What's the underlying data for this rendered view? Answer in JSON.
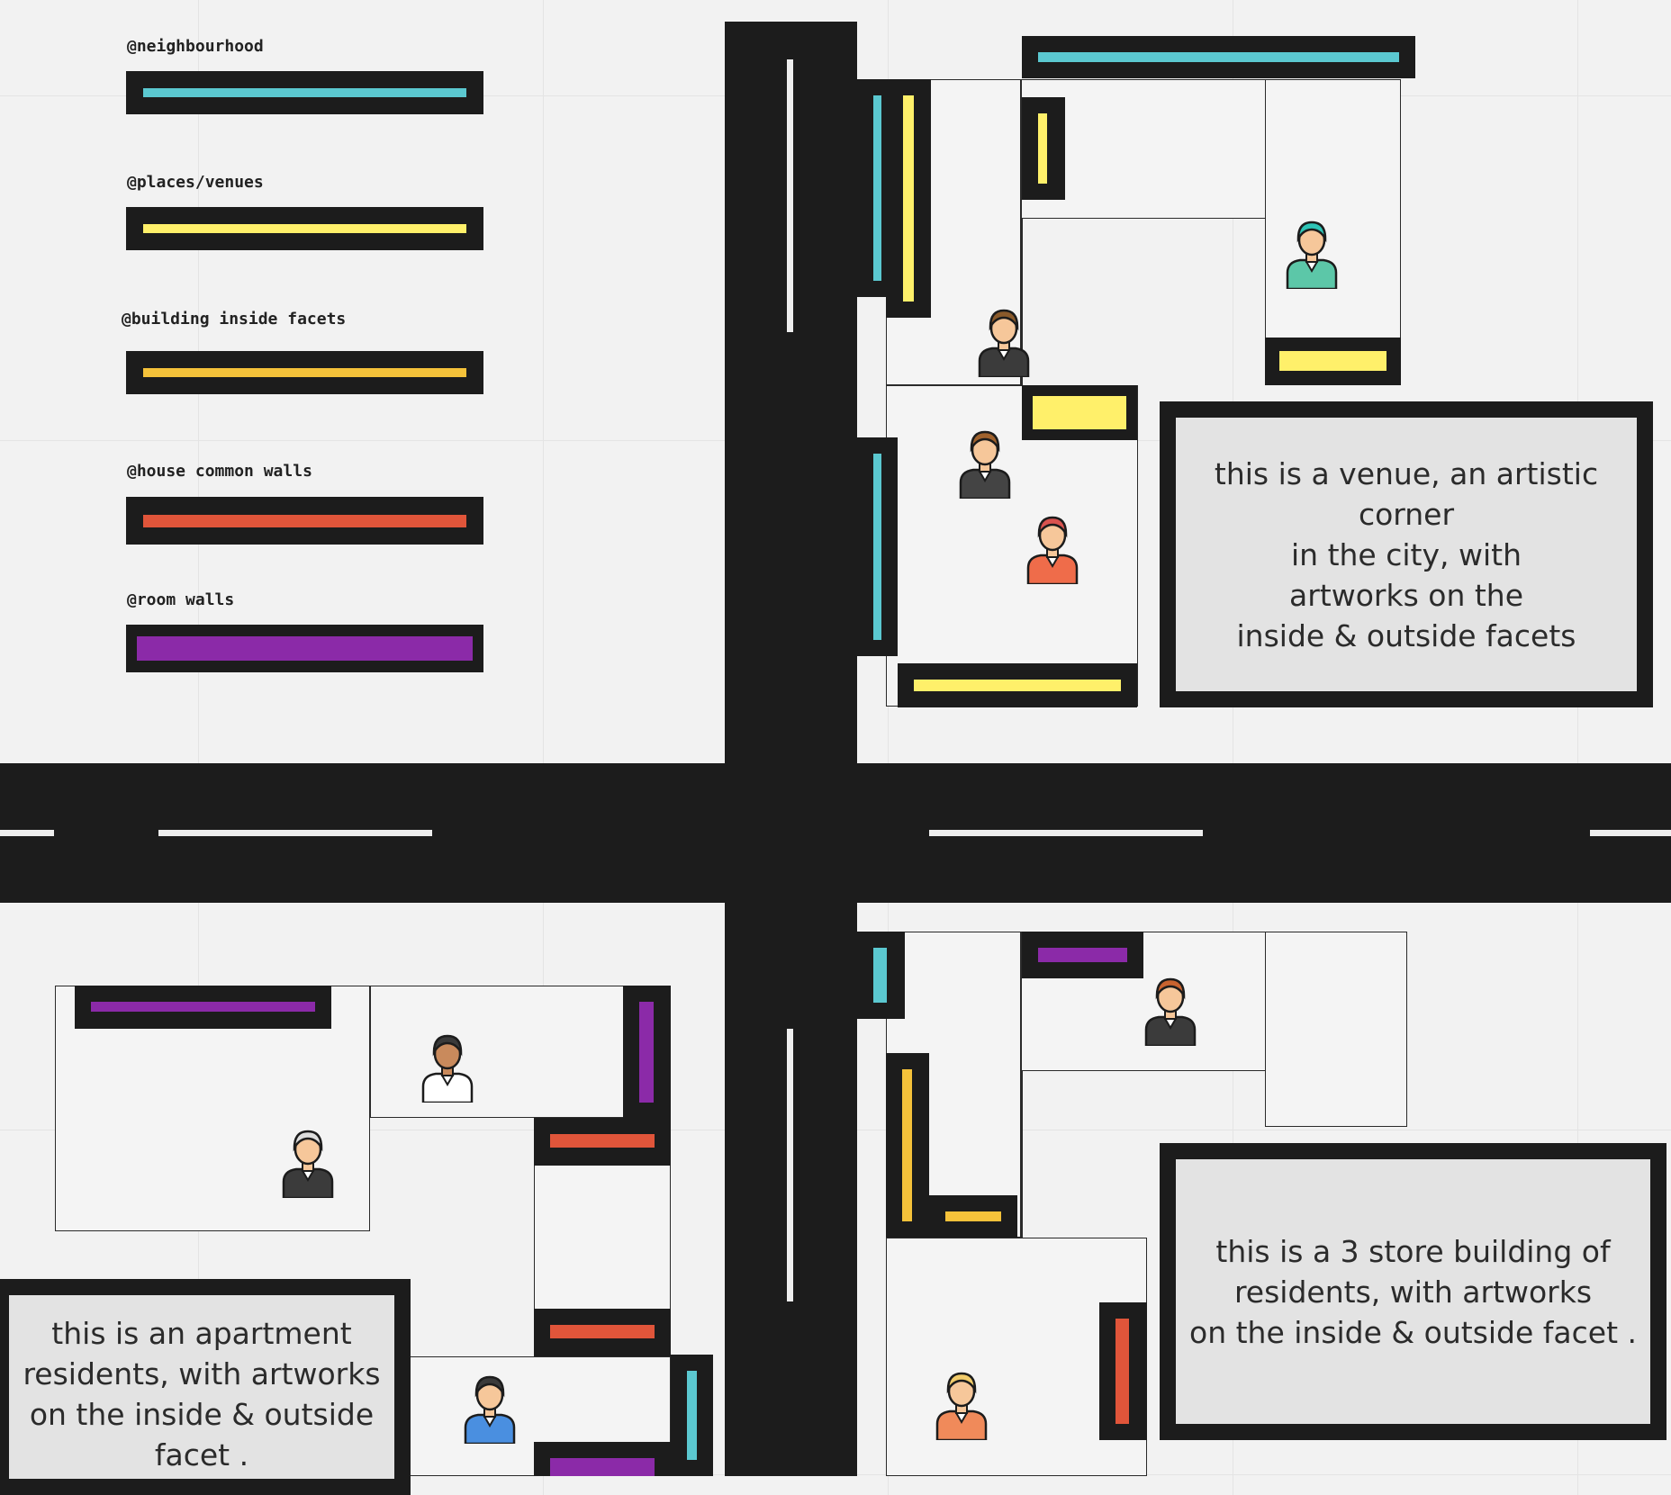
{
  "legend": [
    {
      "label": "@neighbourhood",
      "color": "#5bc8d0"
    },
    {
      "label": "@places/venues",
      "color": "#fff06a"
    },
    {
      "label": "@building inside facets",
      "color": "#f5c23a"
    },
    {
      "label": "@house common walls",
      "color": "#e0553a"
    },
    {
      "label": "@room walls",
      "color": "#8b2aa8"
    }
  ],
  "notes": {
    "venue": "this is a venue, an artistic corner\nin the city, with\nartworks on the\ninside &  outside facets",
    "building": "this is a 3 store building of\nresidents, with artworks\non the inside & outside facet .",
    "apartment": "this is an apartment\nresidents, with artworks\non the inside & outside\nfacet ."
  },
  "people": [
    {
      "name": "man-glasses-woman-icon",
      "hair": "#8a5a2b",
      "skin": "#f6c79a",
      "shirt": "#3b3b3b"
    },
    {
      "name": "surgeon-icon",
      "hair": "#2ec4b6",
      "skin": "#f6c79a",
      "shirt": "#5cc7a8"
    },
    {
      "name": "businesswoman-icon",
      "hair": "#a0622d",
      "skin": "#f6c79a",
      "shirt": "#444444"
    },
    {
      "name": "racer-icon",
      "hair": "#d9534f",
      "skin": "#f6c79a",
      "shirt": "#ef6c4a"
    },
    {
      "name": "bearded-man-icon",
      "hair": "#3a3a3a",
      "skin": "#c98a5c",
      "shirt": "#ffffff"
    },
    {
      "name": "priest-icon",
      "hair": "#dddddd",
      "skin": "#f6c79a",
      "shirt": "#3b3b3b"
    },
    {
      "name": "woman-blue-icon",
      "hair": "#3a3a3a",
      "skin": "#f6c79a",
      "shirt": "#4a8fe0"
    },
    {
      "name": "redhead-businessman-icon",
      "hair": "#c8632f",
      "skin": "#f6c79a",
      "shirt": "#3b3b3b"
    },
    {
      "name": "blonde-woman-icon",
      "hair": "#f2cc6a",
      "skin": "#f6c79a",
      "shirt": "#f08a5a"
    }
  ]
}
